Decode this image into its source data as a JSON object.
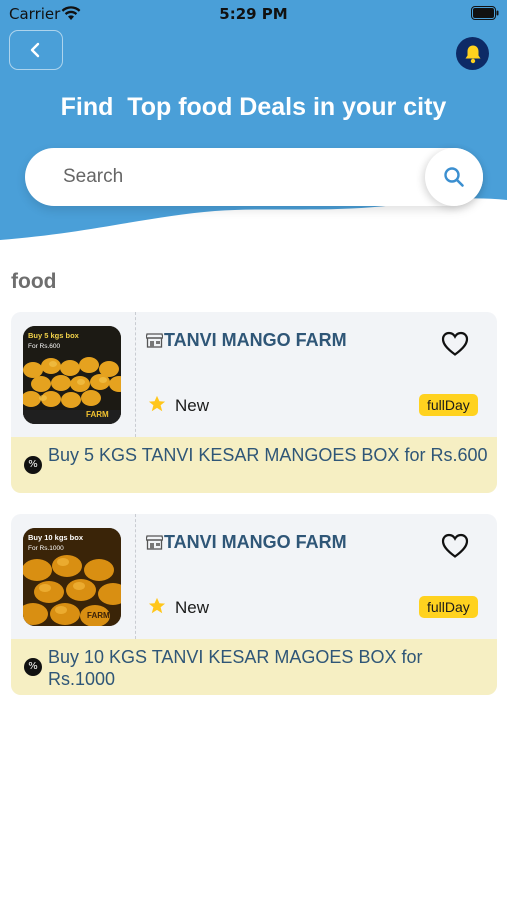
{
  "status_bar": {
    "carrier": "Carrier",
    "time": "5:29 PM"
  },
  "header": {
    "title": "Find  Top food Deals in your city",
    "back_icon": "chevron-left-icon",
    "bell_icon": "bell-icon"
  },
  "search": {
    "placeholder": "Search",
    "value": "",
    "icon": "search-icon"
  },
  "section": {
    "title": "food"
  },
  "colors": {
    "header_blue": "#4a9fd8",
    "tag_yellow": "#ffd21f",
    "offer_bg": "#f6efc3",
    "shop_name": "#2f5677",
    "bell_bg": "#0d2a66"
  },
  "deals": [
    {
      "shop_name": "TANVI MANGO FARM",
      "status": "New",
      "tag": "fullDay",
      "offer": "Buy 5 KGS TANVI KESAR MANGOES BOX for Rs.600",
      "thumb_line1": "Buy 5 kgs box",
      "thumb_line2": "For Rs.600",
      "thumb_brand": "FARM"
    },
    {
      "shop_name": "TANVI MANGO FARM",
      "status": "New",
      "tag": "fullDay",
      "offer": "Buy 10 KGS TANVI KESAR MAGOES BOX for Rs.1000",
      "thumb_line1": "Buy 10 kgs box",
      "thumb_line2": "For Rs.1000",
      "thumb_brand": "FARM"
    }
  ]
}
